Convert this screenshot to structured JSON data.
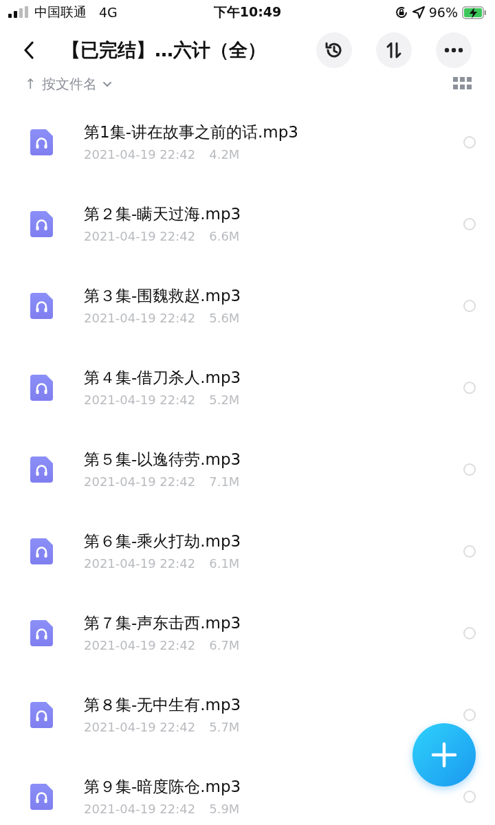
{
  "status_bar": {
    "carrier": "中国联通",
    "network": "4G",
    "time": "下午10:49",
    "battery": "96%"
  },
  "header": {
    "title": "【已完结】…六计（全）"
  },
  "sort": {
    "arrow": "↑",
    "label": "按文件名"
  },
  "files": [
    {
      "name": "第1集-讲在故事之前的话.mp3",
      "date": "2021-04-19 22:42",
      "size": "4.2M",
      "selected": false
    },
    {
      "name": "第２集-瞒天过海.mp3",
      "date": "2021-04-19 22:42",
      "size": "6.6M",
      "selected": false
    },
    {
      "name": "第３集-围魏救赵.mp3",
      "date": "2021-04-19 22:42",
      "size": "5.6M",
      "selected": false
    },
    {
      "name": "第４集-借刀杀人.mp3",
      "date": "2021-04-19 22:42",
      "size": "5.2M",
      "selected": false
    },
    {
      "name": "第５集-以逸待劳.mp3",
      "date": "2021-04-19 22:42",
      "size": "7.1M",
      "selected": false
    },
    {
      "name": "第６集-乘火打劫.mp3",
      "date": "2021-04-19 22:42",
      "size": "6.1M",
      "selected": false
    },
    {
      "name": "第７集-声东击西.mp3",
      "date": "2021-04-19 22:42",
      "size": "6.7M",
      "selected": false
    },
    {
      "name": "第８集-无中生有.mp3",
      "date": "2021-04-19 22:42",
      "size": "5.7M",
      "selected": false
    },
    {
      "name": "第９集-暗度陈仓.mp3",
      "date": "2021-04-19 22:42",
      "size": "5.9M",
      "selected": false
    }
  ]
}
